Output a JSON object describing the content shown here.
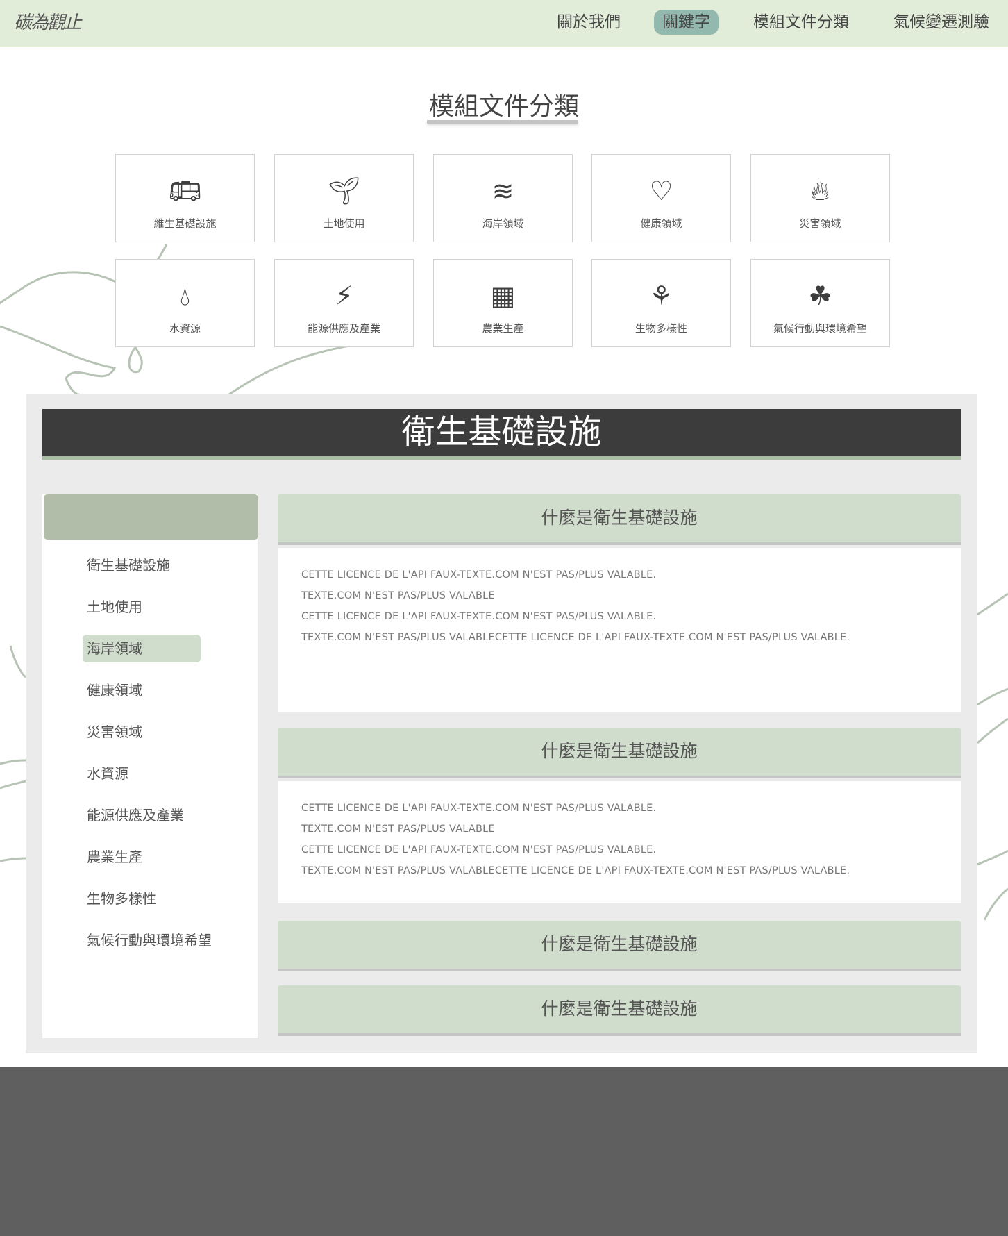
{
  "header": {
    "logo": "碳為觀止",
    "nav": [
      {
        "label": "關於我們"
      },
      {
        "label": "關鍵字",
        "active": true
      },
      {
        "label": "模組文件分類"
      },
      {
        "label": "氣候變遷測驗"
      }
    ]
  },
  "page_title": "模組文件分類",
  "categories": [
    {
      "label": "維生基礎設施",
      "icon": "bus-icon"
    },
    {
      "label": "土地使用",
      "icon": "sprout-icon"
    },
    {
      "label": "海岸領域",
      "icon": "waves-icon"
    },
    {
      "label": "健康領域",
      "icon": "heart-plus-icon"
    },
    {
      "label": "災害領域",
      "icon": "fire-icon"
    },
    {
      "label": "水資源",
      "icon": "water-drop-icon"
    },
    {
      "label": "能源供應及產業",
      "icon": "lightning-icon"
    },
    {
      "label": "農業生產",
      "icon": "farm-field-icon"
    },
    {
      "label": "生物多樣性",
      "icon": "biodiversity-icon"
    },
    {
      "label": "氣候行動與環境希望",
      "icon": "hand-plant-icon"
    }
  ],
  "section": {
    "title": "衛生基礎設施",
    "sidebar": [
      "衛生基礎設施",
      "土地使用",
      "海岸領域",
      "健康領域",
      "災害領域",
      "水資源",
      "能源供應及產業",
      "農業生產",
      "生物多樣性",
      "氣候行動與環境希望"
    ],
    "sidebar_active": "海岸領域",
    "cards": [
      {
        "title": "什麼是衛生基礎設施",
        "lines": [
          "CETTE LICENCE DE L'API FAUX-TEXTE.COM N'EST PAS/PLUS VALABLE.",
          "TEXTE.COM N'EST PAS/PLUS VALABLE",
          "CETTE LICENCE DE L'API FAUX-TEXTE.COM N'EST PAS/PLUS VALABLE.",
          "TEXTE.COM N'EST PAS/PLUS VALABLECETTE LICENCE DE L'API FAUX-TEXTE.COM N'EST PAS/PLUS VALABLE."
        ]
      },
      {
        "title": "什麼是衛生基礎設施",
        "lines": [
          "CETTE LICENCE DE L'API FAUX-TEXTE.COM N'EST PAS/PLUS VALABLE.",
          "TEXTE.COM N'EST PAS/PLUS VALABLE",
          "CETTE LICENCE DE L'API FAUX-TEXTE.COM N'EST PAS/PLUS VALABLE.",
          "TEXTE.COM N'EST PAS/PLUS VALABLECETTE LICENCE DE L'API FAUX-TEXTE.COM N'EST PAS/PLUS VALABLE."
        ]
      },
      {
        "title": "什麼是衛生基礎設施"
      },
      {
        "title": "什麼是衛生基礎設施"
      }
    ]
  },
  "colors": {
    "header_bg": "#e2edd9",
    "nav_active": "#93b8ad",
    "banner": "#3c3c3c",
    "card_header": "#d1ddcc",
    "footer": "#5f5f5f"
  }
}
